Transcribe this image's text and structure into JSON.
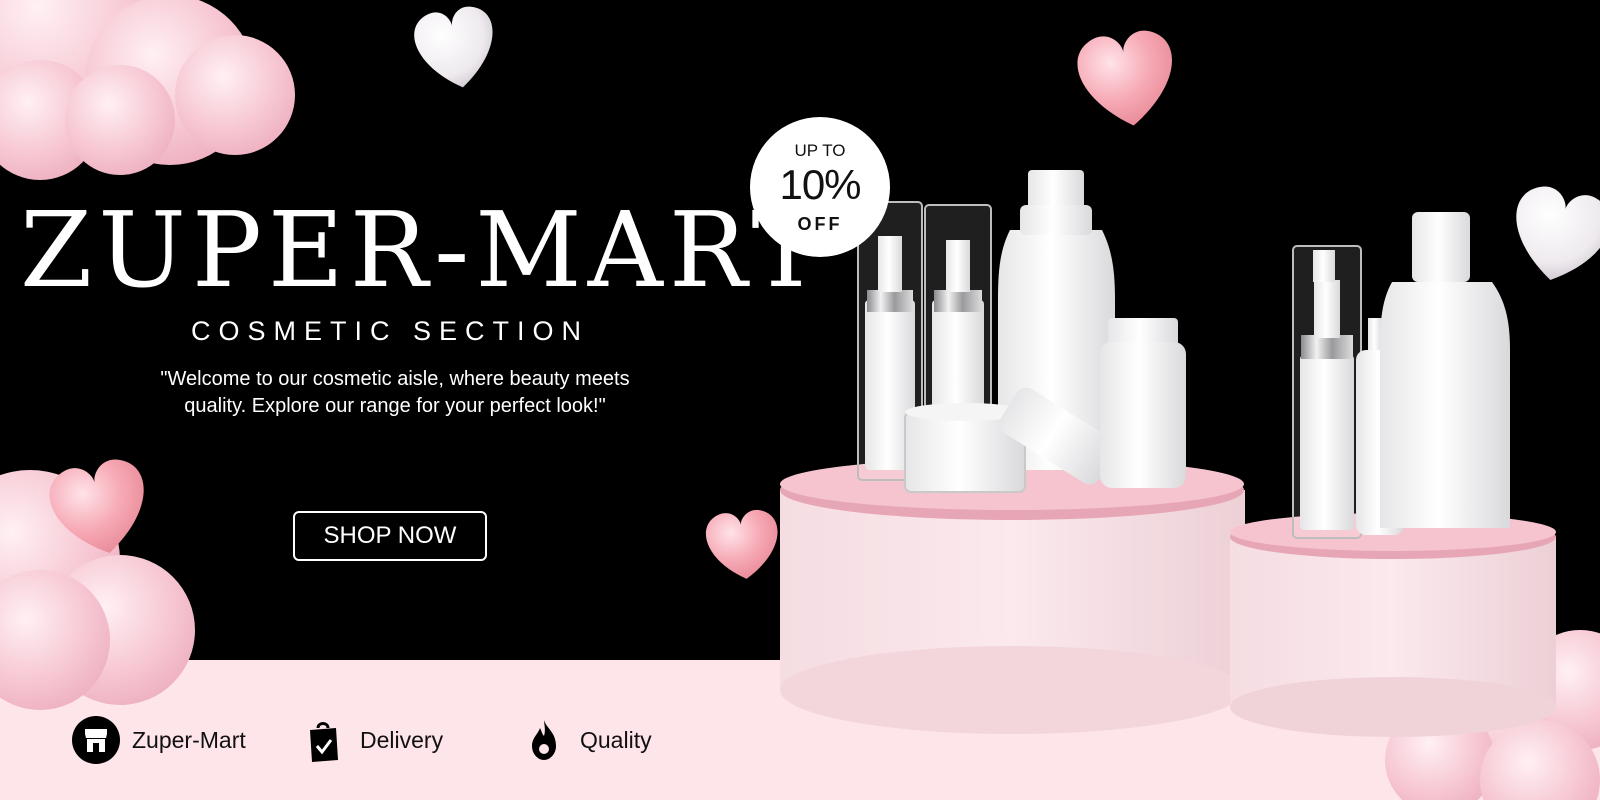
{
  "brand": {
    "title": "ZUPER-MART",
    "subtitle": "COSMETIC SECTION"
  },
  "tagline": "\"Welcome to our cosmetic aisle, where beauty meets quality. Explore our range for your perfect look!\"",
  "cta": {
    "label": "SHOP NOW"
  },
  "promo": {
    "line1": "UP TO",
    "value": "10%",
    "line2": "OFF"
  },
  "features": [
    {
      "label": "Zuper-Mart",
      "icon": "store-icon"
    },
    {
      "label": "Delivery",
      "icon": "shopping-bag-check-icon"
    },
    {
      "label": "Quality",
      "icon": "flame-icon"
    }
  ],
  "colors": {
    "background": "#000000",
    "band": "#fde5ea",
    "pink": "#f4b6c2",
    "podium": "#f3d9de",
    "text_light": "#ffffff"
  }
}
